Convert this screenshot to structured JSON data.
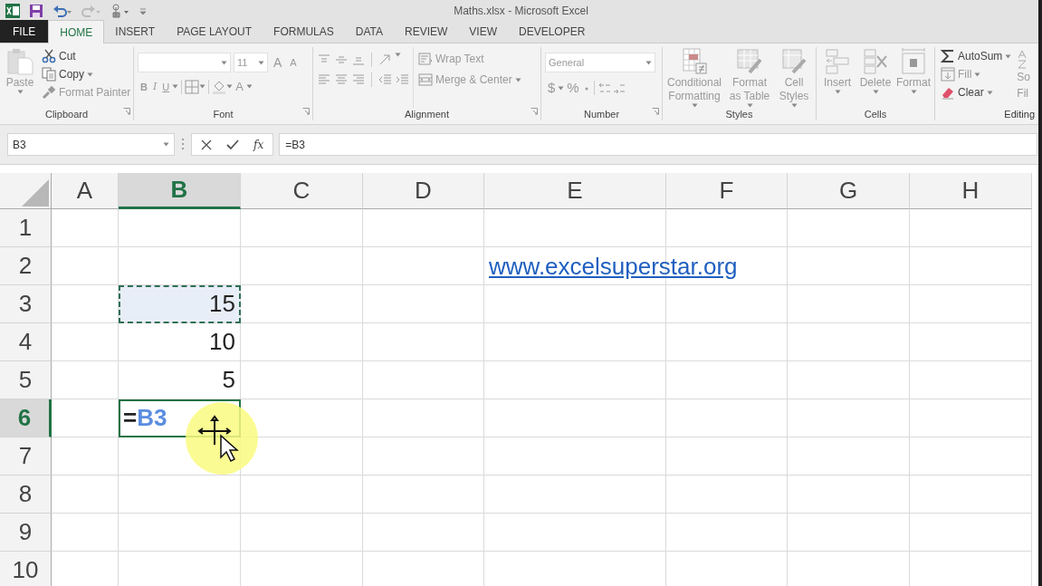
{
  "window": {
    "title": "Maths.xlsx - Microsoft Excel"
  },
  "tabs": [
    {
      "label": "FILE",
      "kind": "file",
      "selected": false
    },
    {
      "label": "HOME",
      "kind": "tab",
      "selected": true
    },
    {
      "label": "INSERT",
      "kind": "tab",
      "selected": false
    },
    {
      "label": "PAGE LAYOUT",
      "kind": "tab",
      "selected": false
    },
    {
      "label": "FORMULAS",
      "kind": "tab",
      "selected": false
    },
    {
      "label": "DATA",
      "kind": "tab",
      "selected": false
    },
    {
      "label": "REVIEW",
      "kind": "tab",
      "selected": false
    },
    {
      "label": "VIEW",
      "kind": "tab",
      "selected": false
    },
    {
      "label": "DEVELOPER",
      "kind": "tab",
      "selected": false
    }
  ],
  "ribbon": {
    "clipboard": {
      "label": "Clipboard",
      "launcher": true,
      "paste": {
        "label": "Paste",
        "disabled": true
      },
      "commands": [
        {
          "label": "Cut",
          "dropdown": false,
          "disabled": false
        },
        {
          "label": "Copy",
          "dropdown": true,
          "disabled": false
        },
        {
          "label": "Format Painter",
          "dropdown": false,
          "disabled": true
        }
      ]
    },
    "font": {
      "label": "Font",
      "launcher": true,
      "disabled": true,
      "size": "11",
      "grow": "A",
      "shrink": "A",
      "bold": "B",
      "italic": "I",
      "underline": "U",
      "font_color": "A"
    },
    "alignment": {
      "label": "Alignment",
      "launcher": true,
      "commands": [
        {
          "label": "Wrap Text",
          "dropdown": false,
          "disabled": true
        },
        {
          "label": "Merge & Center",
          "dropdown": true,
          "disabled": true
        }
      ]
    },
    "number": {
      "label": "Number",
      "launcher": true,
      "disabled": true,
      "format": "General",
      "currency": "$",
      "percent": "%"
    },
    "styles": {
      "label": "Styles",
      "commands": [
        {
          "label": "Conditional Formatting",
          "dropdown": true,
          "disabled": true
        },
        {
          "label": "Format as Table",
          "dropdown": true,
          "disabled": true
        },
        {
          "label": "Cell Styles",
          "dropdown": true,
          "disabled": true
        }
      ]
    },
    "cells": {
      "label": "Cells",
      "commands": [
        {
          "label": "Insert",
          "dropdown": true,
          "disabled": true
        },
        {
          "label": "Delete",
          "dropdown": true,
          "disabled": true
        },
        {
          "label": "Format",
          "dropdown": true,
          "disabled": true
        }
      ]
    },
    "editing": {
      "label": "Editing",
      "commands": [
        {
          "label": "AutoSum",
          "dropdown": true,
          "disabled": false
        },
        {
          "label": "Fill",
          "dropdown": true,
          "disabled": true
        },
        {
          "label": "Clear",
          "dropdown": true,
          "disabled": false
        }
      ],
      "sort_lines": [
        "So",
        "Fil"
      ]
    }
  },
  "formula_bar": {
    "name_box": "B3",
    "function_label": "fx",
    "formula": "=B3"
  },
  "sheet": {
    "columns": [
      {
        "label": "A",
        "selected": false
      },
      {
        "label": "B",
        "selected": true
      },
      {
        "label": "C",
        "selected": false
      },
      {
        "label": "D",
        "selected": false
      },
      {
        "label": "E",
        "selected": false
      },
      {
        "label": "F",
        "selected": false
      },
      {
        "label": "G",
        "selected": false
      },
      {
        "label": "H",
        "selected": false
      }
    ],
    "rows": [
      {
        "label": "1",
        "selected": false
      },
      {
        "label": "2",
        "selected": false,
        "cells": [
          {},
          {},
          {},
          {},
          {
            "value": "www.excelsuperstar.org",
            "kind": "link"
          }
        ]
      },
      {
        "label": "3",
        "selected": false,
        "cells": [
          {},
          {
            "value": "15",
            "kind": "number",
            "copy_marquee": true
          }
        ]
      },
      {
        "label": "4",
        "selected": false,
        "cells": [
          {},
          {
            "value": "10",
            "kind": "number"
          }
        ]
      },
      {
        "label": "5",
        "selected": false,
        "cells": [
          {},
          {
            "value": "5",
            "kind": "number"
          }
        ]
      },
      {
        "label": "6",
        "selected": true,
        "cells": [
          {},
          {
            "kind": "editing",
            "prefix": "=",
            "reference": "B3",
            "active": true
          }
        ]
      },
      {
        "label": "7",
        "selected": false
      },
      {
        "label": "8",
        "selected": false
      },
      {
        "label": "9",
        "selected": false
      },
      {
        "label": "10",
        "selected": false
      }
    ]
  }
}
